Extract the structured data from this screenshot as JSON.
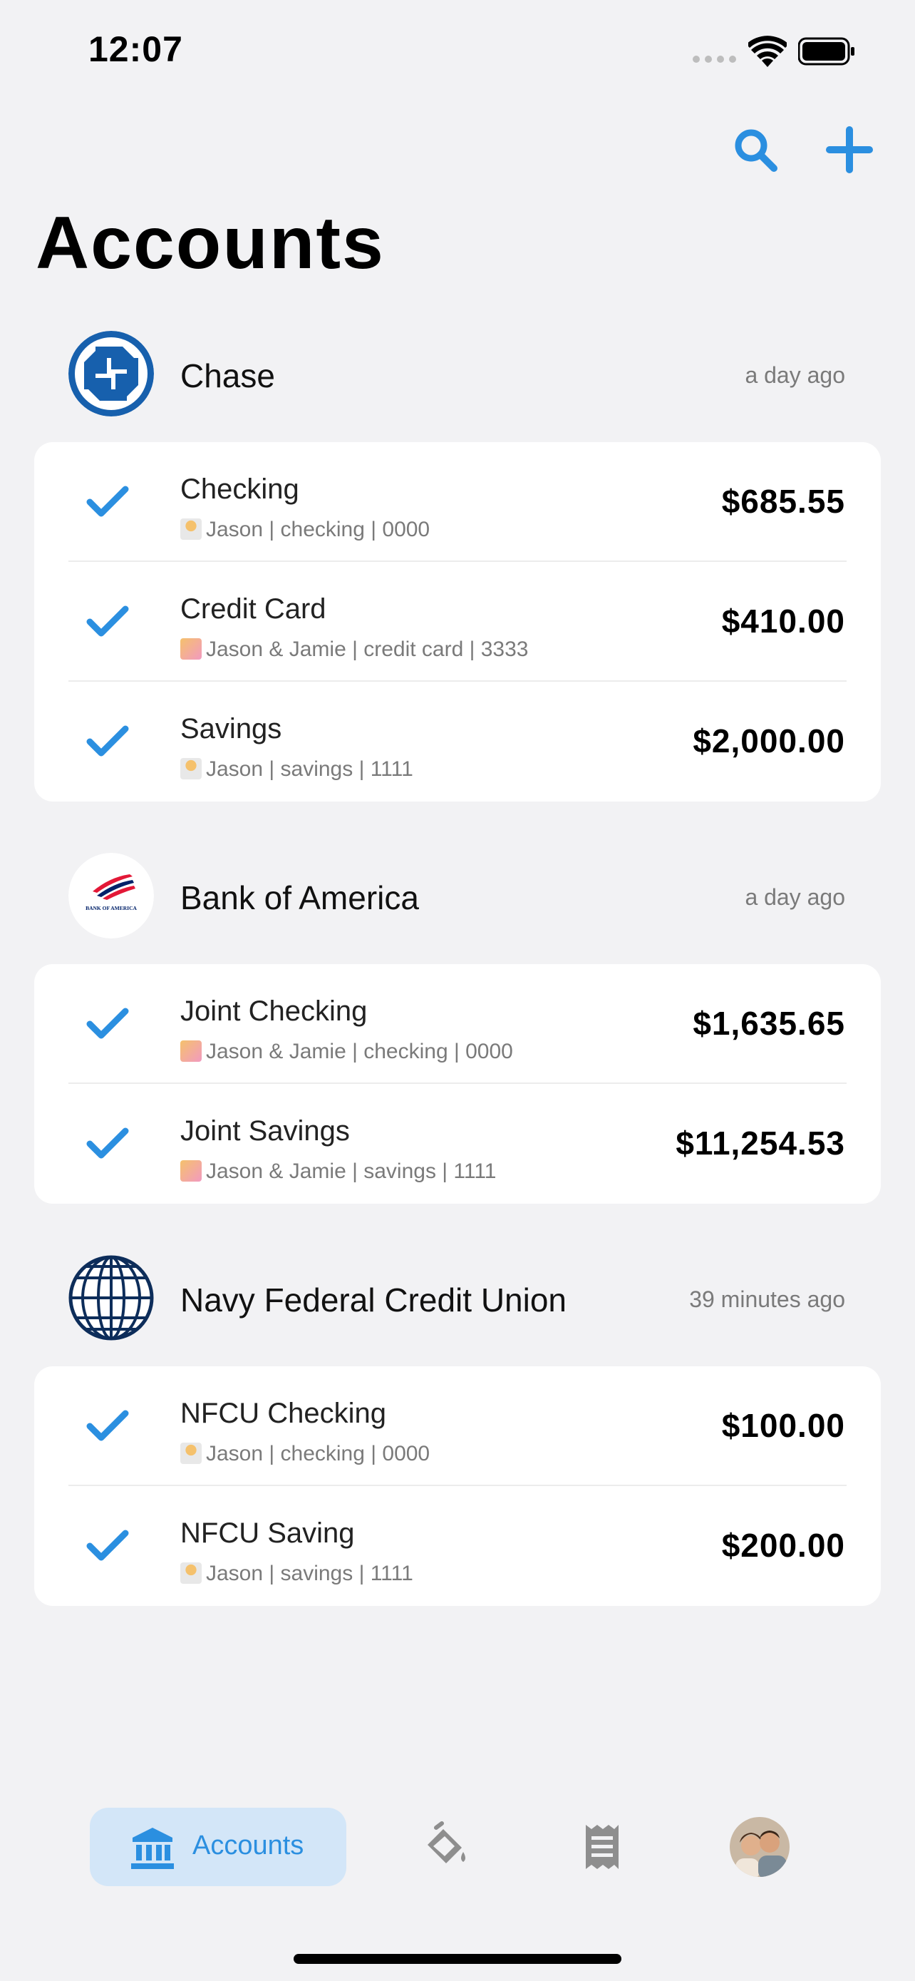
{
  "status_bar": {
    "time": "12:07"
  },
  "header": {
    "title": "Accounts"
  },
  "accent_color": "#2b8fe0",
  "institutions": [
    {
      "name": "Chase",
      "updated": "a day ago",
      "logo": "chase-logo",
      "accounts": [
        {
          "name": "Checking",
          "detail": "Jason | checking | 0000",
          "owner_icon": "person-emoji",
          "balance": "$685.55"
        },
        {
          "name": "Credit Card",
          "detail": "Jason & Jamie | credit card | 3333",
          "owner_icon": "couple-emoji",
          "balance": "$410.00"
        },
        {
          "name": "Savings",
          "detail": "Jason | savings | 1111",
          "owner_icon": "person-emoji",
          "balance": "$2,000.00"
        }
      ]
    },
    {
      "name": "Bank of America",
      "updated": "a day ago",
      "logo": "bank-of-america-logo",
      "logo_text": "BANK OF AMERICA",
      "accounts": [
        {
          "name": "Joint Checking",
          "detail": "Jason & Jamie | checking | 0000",
          "owner_icon": "couple-emoji",
          "balance": "$1,635.65"
        },
        {
          "name": "Joint Savings",
          "detail": "Jason & Jamie | savings | 1111",
          "owner_icon": "couple-emoji",
          "balance": "$11,254.53"
        }
      ]
    },
    {
      "name": "Navy Federal Credit Union",
      "updated": "39 minutes ago",
      "logo": "globe-logo",
      "accounts": [
        {
          "name": "NFCU Checking",
          "detail": "Jason | checking | 0000",
          "owner_icon": "person-emoji",
          "balance": "$100.00"
        },
        {
          "name": "NFCU Saving",
          "detail": "Jason | savings | 1111",
          "owner_icon": "person-emoji",
          "balance": "$200.00"
        }
      ]
    }
  ],
  "tab_bar": {
    "tabs": [
      {
        "label": "Accounts",
        "icon": "bank-icon",
        "selected": true
      },
      {
        "label": "",
        "icon": "paint-bucket-icon",
        "selected": false
      },
      {
        "label": "",
        "icon": "receipt-icon",
        "selected": false
      },
      {
        "label": "",
        "icon": "profile-avatar",
        "selected": false
      }
    ]
  }
}
